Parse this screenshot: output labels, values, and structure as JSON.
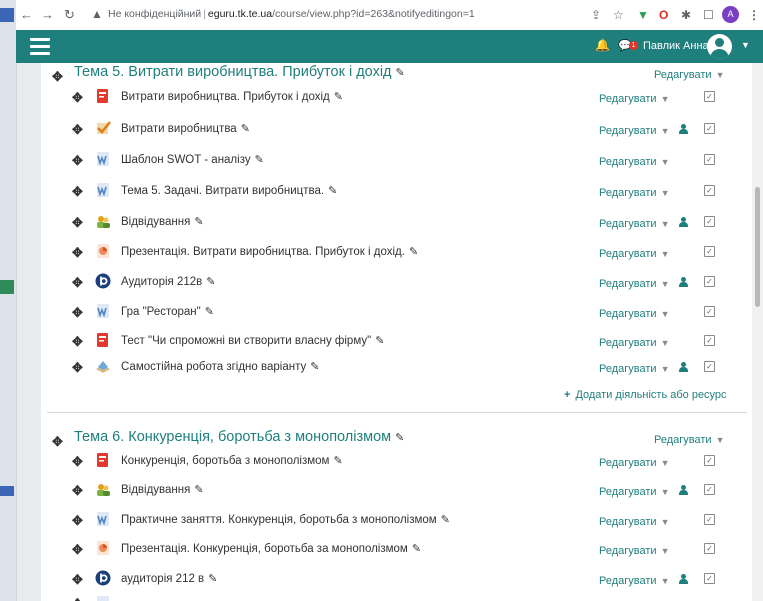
{
  "browser": {
    "security_label": "Не конфіденційний",
    "domain": "eguru.tk.te.ua",
    "path": "/course/view.php?id=263&notifyeditingon=1",
    "profile_initial": "A"
  },
  "navbar": {
    "user_name": "Павлик Анна",
    "message_badge": "1"
  },
  "colors": {
    "accent": "#1f7f7d",
    "navbar": "#1f7f7d",
    "pdf": "#e23a2d",
    "doc": "#4f86c6"
  },
  "sections": [
    {
      "title": "Тема 5. Витрати виробництва. Прибуток і дохід",
      "edit_label": "Редагувати",
      "activities": [
        {
          "name": "Витрати виробництва. Прибуток і дохід",
          "icon": "pdf-icon",
          "edit": "Редагувати",
          "restricted": false
        },
        {
          "name": "Витрати виробництва",
          "icon": "assignment-icon",
          "edit": "Редагувати",
          "restricted": true
        },
        {
          "name": "Шаблон SWOT - аналізу",
          "icon": "word-doc-icon",
          "edit": "Редагувати",
          "restricted": false
        },
        {
          "name": "Тема 5. Задачі. Витрати виробництва.",
          "icon": "word-doc-icon",
          "edit": "Редагувати",
          "restricted": false
        },
        {
          "name": "Відвідування",
          "icon": "attendance-icon",
          "edit": "Редагувати",
          "restricted": true
        },
        {
          "name": "Презентація. Витрати виробництва. Прибуток і дохід.",
          "icon": "powerpoint-icon",
          "edit": "Редагувати",
          "restricted": false
        },
        {
          "name": "Аудиторія 212в",
          "icon": "bigbluebutton-icon",
          "edit": "Редагувати",
          "restricted": true
        },
        {
          "name": "Гра \"Ресторан\"",
          "icon": "word-doc-icon",
          "edit": "Редагувати",
          "restricted": false
        },
        {
          "name": "Тест \"Чи спроможні ви створити власну фірму\"",
          "icon": "pdf-icon",
          "edit": "Редагувати",
          "restricted": false
        },
        {
          "name": "Самостійна робота згідно варіанту",
          "icon": "workshop-icon",
          "edit": "Редагувати",
          "restricted": true
        }
      ],
      "add_activity_label": "Додати діяльність або ресурс"
    },
    {
      "title": "Тема 6. Конкуренція, боротьба з монополізмом",
      "edit_label": "Редагувати",
      "activities": [
        {
          "name": "Конкуренція, боротьба з монополізмом",
          "icon": "pdf-icon",
          "edit": "Редагувати",
          "restricted": false
        },
        {
          "name": "Відвідування",
          "icon": "attendance-icon",
          "edit": "Редагувати",
          "restricted": true
        },
        {
          "name": "Практичне заняття. Конкуренція, боротьба з монополізмом",
          "icon": "word-doc-icon",
          "edit": "Редагувати",
          "restricted": false
        },
        {
          "name": "Презентація. Конкуренція, боротьба за монополізмом",
          "icon": "powerpoint-icon",
          "edit": "Редагувати",
          "restricted": false
        },
        {
          "name": "аудиторія 212 в",
          "icon": "bigbluebutton-icon",
          "edit": "Редагувати",
          "restricted": true
        }
      ]
    }
  ]
}
